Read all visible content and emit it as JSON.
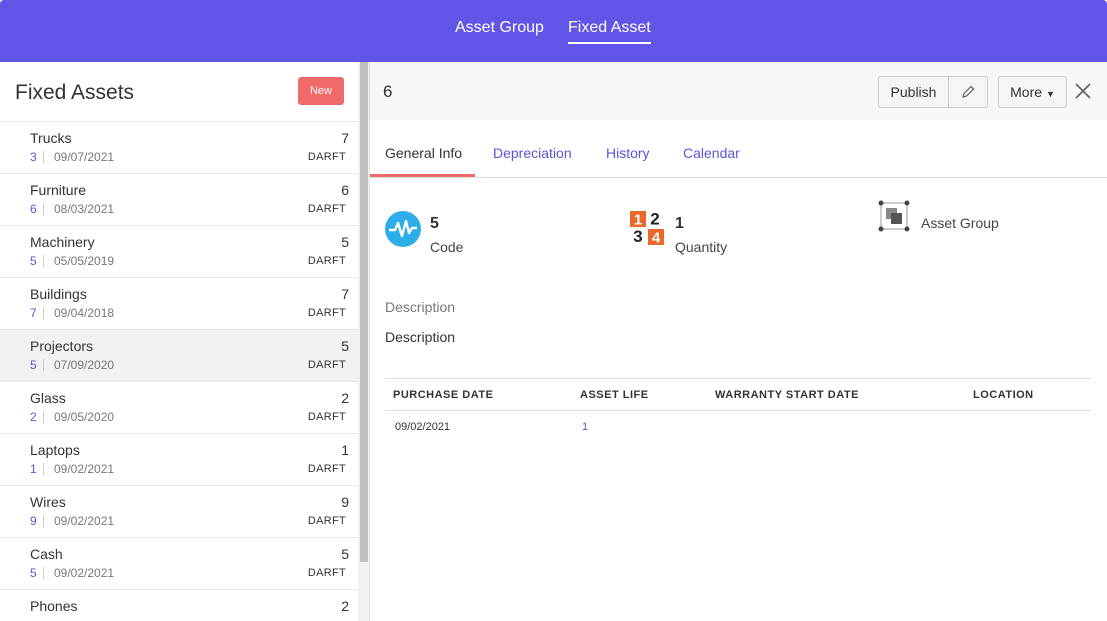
{
  "topnav": {
    "items": [
      "Asset Group",
      "Fixed Asset"
    ],
    "active": "Fixed Asset"
  },
  "left": {
    "title": "Fixed Assets",
    "new_label": "New",
    "items": [
      {
        "name": "Trucks",
        "count": "7",
        "qty": "3",
        "date": "09/07/2021",
        "status": "DARFT"
      },
      {
        "name": "Furniture",
        "count": "6",
        "qty": "6",
        "date": "08/03/2021",
        "status": "DARFT"
      },
      {
        "name": "Machinery",
        "count": "5",
        "qty": "5",
        "date": "05/05/2019",
        "status": "DARFT"
      },
      {
        "name": "Buildings",
        "count": "7",
        "qty": "7",
        "date": "09/04/2018",
        "status": "DARFT"
      },
      {
        "name": "Projectors",
        "count": "5",
        "qty": "5",
        "date": "07/09/2020",
        "status": "DARFT"
      },
      {
        "name": "Glass",
        "count": "2",
        "qty": "2",
        "date": "09/05/2020",
        "status": "DARFT"
      },
      {
        "name": "Laptops",
        "count": "1",
        "qty": "1",
        "date": "09/02/2021",
        "status": "DARFT"
      },
      {
        "name": "Wires",
        "count": "9",
        "qty": "9",
        "date": "09/02/2021",
        "status": "DARFT"
      },
      {
        "name": "Cash",
        "count": "5",
        "qty": "5",
        "date": "09/02/2021",
        "status": "DARFT"
      },
      {
        "name": "Phones",
        "count": "2",
        "qty": "",
        "date": "",
        "status": ""
      }
    ],
    "selected_index": 4
  },
  "detail": {
    "title": "6",
    "publish_label": "Publish",
    "more_label": "More",
    "icons": {
      "edit": "pencil-icon",
      "more": "caret-down-icon",
      "close": "close-icon"
    },
    "tabs": [
      "General Info",
      "Depreciation",
      "History",
      "Calendar"
    ],
    "active_tab": "General Info",
    "stats": {
      "code": {
        "value": "5",
        "label": "Code",
        "icon": "pulse-icon"
      },
      "quantity": {
        "value": "1",
        "label": "Quantity",
        "icon": "numbers-icon"
      },
      "asset_group": {
        "label": "Asset Group",
        "icon": "group-icon"
      }
    },
    "description_label": "Description",
    "description_value": "Description",
    "table": {
      "headers": [
        "PURCHASE DATE",
        "ASSET LIFE",
        "WARRANTY START DATE",
        "LOCATION"
      ],
      "rows": [
        [
          "09/02/2021",
          "1",
          "",
          ""
        ]
      ]
    }
  },
  "colors": {
    "brand": "#6055e6",
    "accent": "#f06a6a",
    "link": "#5a55d6",
    "code_icon": "#2eaee8",
    "qty_icon": "#e8692a"
  }
}
